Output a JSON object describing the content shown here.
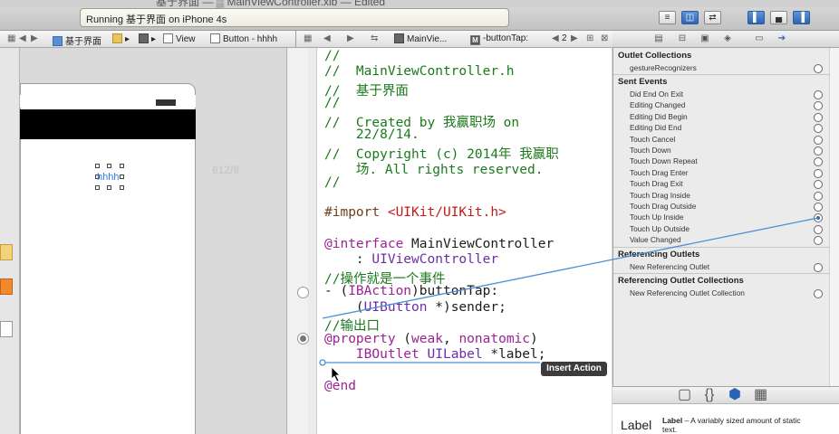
{
  "window": {
    "title": "基于界面 — ▒ MainViewController.xib — Edited"
  },
  "toolbar": {
    "status_text": "Running 基于界面 on iPhone 4s"
  },
  "editor_jumpbar": {
    "crumbs": [
      "基于界面",
      "▸",
      "▸",
      "View",
      "Button - hhhh"
    ]
  },
  "assistant_jumpbar": {
    "crumbs": [
      "MainVie...",
      "-buttonTap:",
      "2"
    ]
  },
  "canvas": {
    "button_title": "hhhh",
    "ghost_text": "612/8"
  },
  "code": {
    "lines": [
      {
        "parts": [
          {
            "t": "//",
            "c": "cm"
          }
        ]
      },
      {
        "parts": [
          {
            "t": "//  MainViewController.h",
            "c": "cm"
          }
        ]
      },
      {
        "parts": [
          {
            "t": "//  基于界面",
            "c": "cm"
          }
        ]
      },
      {
        "parts": [
          {
            "t": "//",
            "c": "cm"
          }
        ]
      },
      {
        "parts": [
          {
            "t": "//  Created by 我赢职场 on",
            "c": "cm"
          }
        ]
      },
      {
        "parts": [
          {
            "t": "    22/8/14.",
            "c": "cm"
          }
        ]
      },
      {
        "parts": [
          {
            "t": "//  Copyright (c) 2014年 我赢职",
            "c": "cm"
          }
        ]
      },
      {
        "parts": [
          {
            "t": "    场. All rights reserved.",
            "c": "cm"
          }
        ]
      },
      {
        "parts": [
          {
            "t": "//",
            "c": "cm"
          }
        ]
      },
      {
        "parts": [
          {
            "t": "#import ",
            "c": "pp"
          },
          {
            "t": "<UIKit/UIKit.h>",
            "c": "st"
          }
        ]
      },
      {
        "parts": [
          {
            "t": "@interface",
            "c": "kw"
          },
          {
            "t": " MainViewController",
            "c": "fn"
          }
        ]
      },
      {
        "parts": [
          {
            "t": "    : ",
            "c": "fn"
          },
          {
            "t": "UIViewController",
            "c": "ty"
          }
        ]
      },
      {
        "parts": [
          {
            "t": "//操作就是一个事件",
            "c": "cm"
          }
        ]
      },
      {
        "parts": [
          {
            "t": "- (",
            "c": "fn"
          },
          {
            "t": "IBAction",
            "c": "kw"
          },
          {
            "t": ")buttonTap:",
            "c": "fn"
          }
        ]
      },
      {
        "parts": [
          {
            "t": "    (",
            "c": "fn"
          },
          {
            "t": "UIButton",
            "c": "ty"
          },
          {
            "t": " *)sender;",
            "c": "fn"
          }
        ]
      },
      {
        "parts": [
          {
            "t": "//输出口",
            "c": "cm"
          }
        ]
      },
      {
        "parts": [
          {
            "t": "@property",
            "c": "kw"
          },
          {
            "t": " (",
            "c": "fn"
          },
          {
            "t": "weak",
            "c": "kw"
          },
          {
            "t": ", ",
            "c": "fn"
          },
          {
            "t": "nonatomic",
            "c": "kw"
          },
          {
            "t": ")",
            "c": "fn"
          }
        ]
      },
      {
        "parts": [
          {
            "t": "    ",
            "c": "fn"
          },
          {
            "t": "IBOutlet",
            "c": "kw"
          },
          {
            "t": " ",
            "c": "fn"
          },
          {
            "t": "UILabel",
            "c": "ty"
          },
          {
            "t": " *label;",
            "c": "fn"
          }
        ]
      },
      {
        "parts": [
          {
            "t": "@end",
            "c": "kw"
          }
        ]
      }
    ]
  },
  "tooltip": {
    "text": "Insert Action"
  },
  "inspector": {
    "outlet_collections": {
      "title": "Outlet Collections",
      "items": [
        "gestureRecognizers"
      ]
    },
    "sent_events": {
      "title": "Sent Events",
      "items": [
        "Did End On Exit",
        "Editing Changed",
        "Editing Did Begin",
        "Editing Did End",
        "Touch Cancel",
        "Touch Down",
        "Touch Down Repeat",
        "Touch Drag Enter",
        "Touch Drag Exit",
        "Touch Drag Inside",
        "Touch Drag Outside",
        "Touch Up Inside",
        "Touch Up Outside",
        "Value Changed"
      ],
      "connected": "Touch Up Inside"
    },
    "referencing_outlets": {
      "title": "Referencing Outlets",
      "items": [
        "New Referencing Outlet"
      ]
    },
    "referencing_outlet_collections": {
      "title": "Referencing Outlet Collections",
      "items": [
        "New Referencing Outlet Collection"
      ]
    }
  },
  "library": {
    "item_icon_label": "Label",
    "item_title": "Label",
    "item_desc": " – A variably sized amount of static text."
  },
  "colors": {
    "connection_line": "#4a90d9",
    "accent": "#2f63b0"
  }
}
